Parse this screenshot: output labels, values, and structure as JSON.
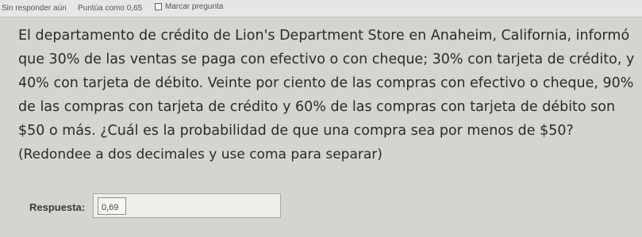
{
  "topbar": {
    "status": "Sin responder aún",
    "points": "Puntúa como 0,65",
    "flag_label": "Marcar pregunta",
    "flag_icon": "flag-checkbox-icon"
  },
  "question": {
    "line1": "El departamento de crédito de Lion's Department Store en Anaheim, California, informó",
    "line2": "que 30% de las ventas se paga con efectivo o con cheque; 30% con tarjeta de crédito, y",
    "line3": "40% con tarjeta de débito. Veinte por ciento de las compras con efectivo o cheque, 90%",
    "line4": "de las compras con tarjeta de crédito y 60% de las compras con tarjeta de débito son",
    "line5": "$50 o más. ¿Cuál es la probabilidad de que una compra sea por menos de $50?",
    "instruction": "(Redondee a dos decimales y use coma para separar)"
  },
  "answer": {
    "label": "Respuesta:",
    "value": "0,69"
  }
}
